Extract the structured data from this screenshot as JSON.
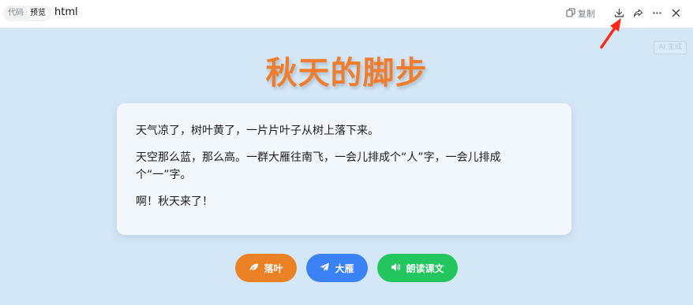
{
  "toolbar": {
    "mode_tabs": [
      {
        "label": "代码",
        "active": false
      },
      {
        "label": "预览",
        "active": true
      }
    ],
    "title": "html",
    "copy_label": "复制",
    "icons": [
      "copy-icon",
      "download-icon",
      "share-icon",
      "more-icon",
      "close-icon"
    ]
  },
  "badge": {
    "label": "AI 生成"
  },
  "page": {
    "title": "秋天的脚步",
    "paragraphs": [
      "天气凉了，树叶黄了，一片片叶子从树上落下来。",
      "天空那么蓝，那么高。一群大雁往南飞，一会儿排成个“人”字，一会儿排成个“一”字。",
      "啊！秋天来了！"
    ]
  },
  "buttons": {
    "leaf": {
      "label": "落叶",
      "icon": "leaf-icon",
      "color": "#ea8124"
    },
    "geese": {
      "label": "大雁",
      "icon": "paper-plane-icon",
      "color": "#3b82f6"
    },
    "read": {
      "label": "朗读课文",
      "icon": "volume-icon",
      "color": "#22c55e"
    }
  },
  "colors": {
    "background": "#d4e7f7",
    "title": "#f07d2d",
    "annotation_arrow": "#ff2a1a"
  }
}
